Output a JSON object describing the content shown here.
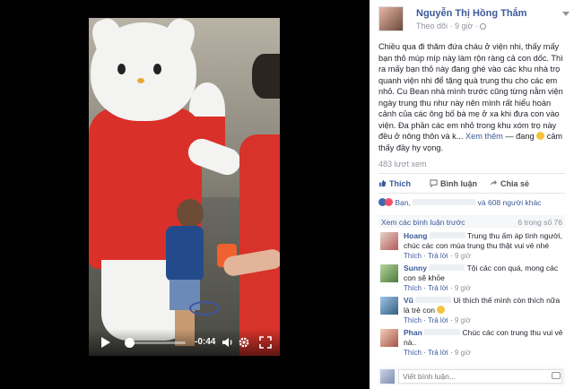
{
  "video": {
    "time_remaining": "-0:44",
    "progress": 0.08
  },
  "post": {
    "author": "Nguyễn Thị Hồng Thắm",
    "meta": "Theo dõi · 9 giờ ·",
    "text_main": "Chiều qua đi thăm đứa cháu ở viện nhi, thấy mấy bạn thỏ múp míp này làm rộn ràng cả con dốc. Thì ra mấy bạn thỏ này đang ghé vào các khu nhà trọ quanh viện nhi để tặng quà trung thu cho các em nhỏ. Cu Bean nhà mình trước cũng từng nằm viện ngày trung thu như này nên mình rất hiểu hoàn cảnh của các ông bố bà mẹ ở xa khi đưa con vào viện. Đa phần các em nhỏ trong khu xóm trọ này đều ở nông thôn và k...",
    "see_more": "Xem thêm",
    "text_tail": "— đang",
    "feeling": "cảm thấy đầy hy vọng.",
    "views": "483 lượt xem"
  },
  "actions": {
    "like": "Thích",
    "comment": "Bình luận",
    "share": "Chia sẻ"
  },
  "likes": {
    "prefix": "Bạn,",
    "suffix": "và 608 người khác"
  },
  "comments_bar": {
    "view_previous": "Xem các bình luận trước",
    "count": "6 trong số 76"
  },
  "comments": [
    {
      "name": "Hoang",
      "text": "Trung thu ấm áp tình người, chúc các con mùa trung thu thật vui vẻ nhé",
      "like": "Thích",
      "reply": "Trả lời",
      "time": "9 giờ"
    },
    {
      "name": "Sunny",
      "text": "Tội các con quá, mong các con sẽ khỏe",
      "like": "Thích",
      "reply": "Trả lời",
      "time": "9 giờ"
    },
    {
      "name": "Vũ",
      "text": "Ui thích thế mình còn thích nữa là trẻ con",
      "like": "Thích",
      "reply": "Trả lời",
      "time": "9 giờ"
    },
    {
      "name": "Phan",
      "text": "Chúc các con trung thu vui vẻ nà..",
      "like": "Thích",
      "reply": "Trả lời",
      "time": "9 giờ"
    }
  ],
  "composer": {
    "placeholder": "Viết bình luận..."
  }
}
